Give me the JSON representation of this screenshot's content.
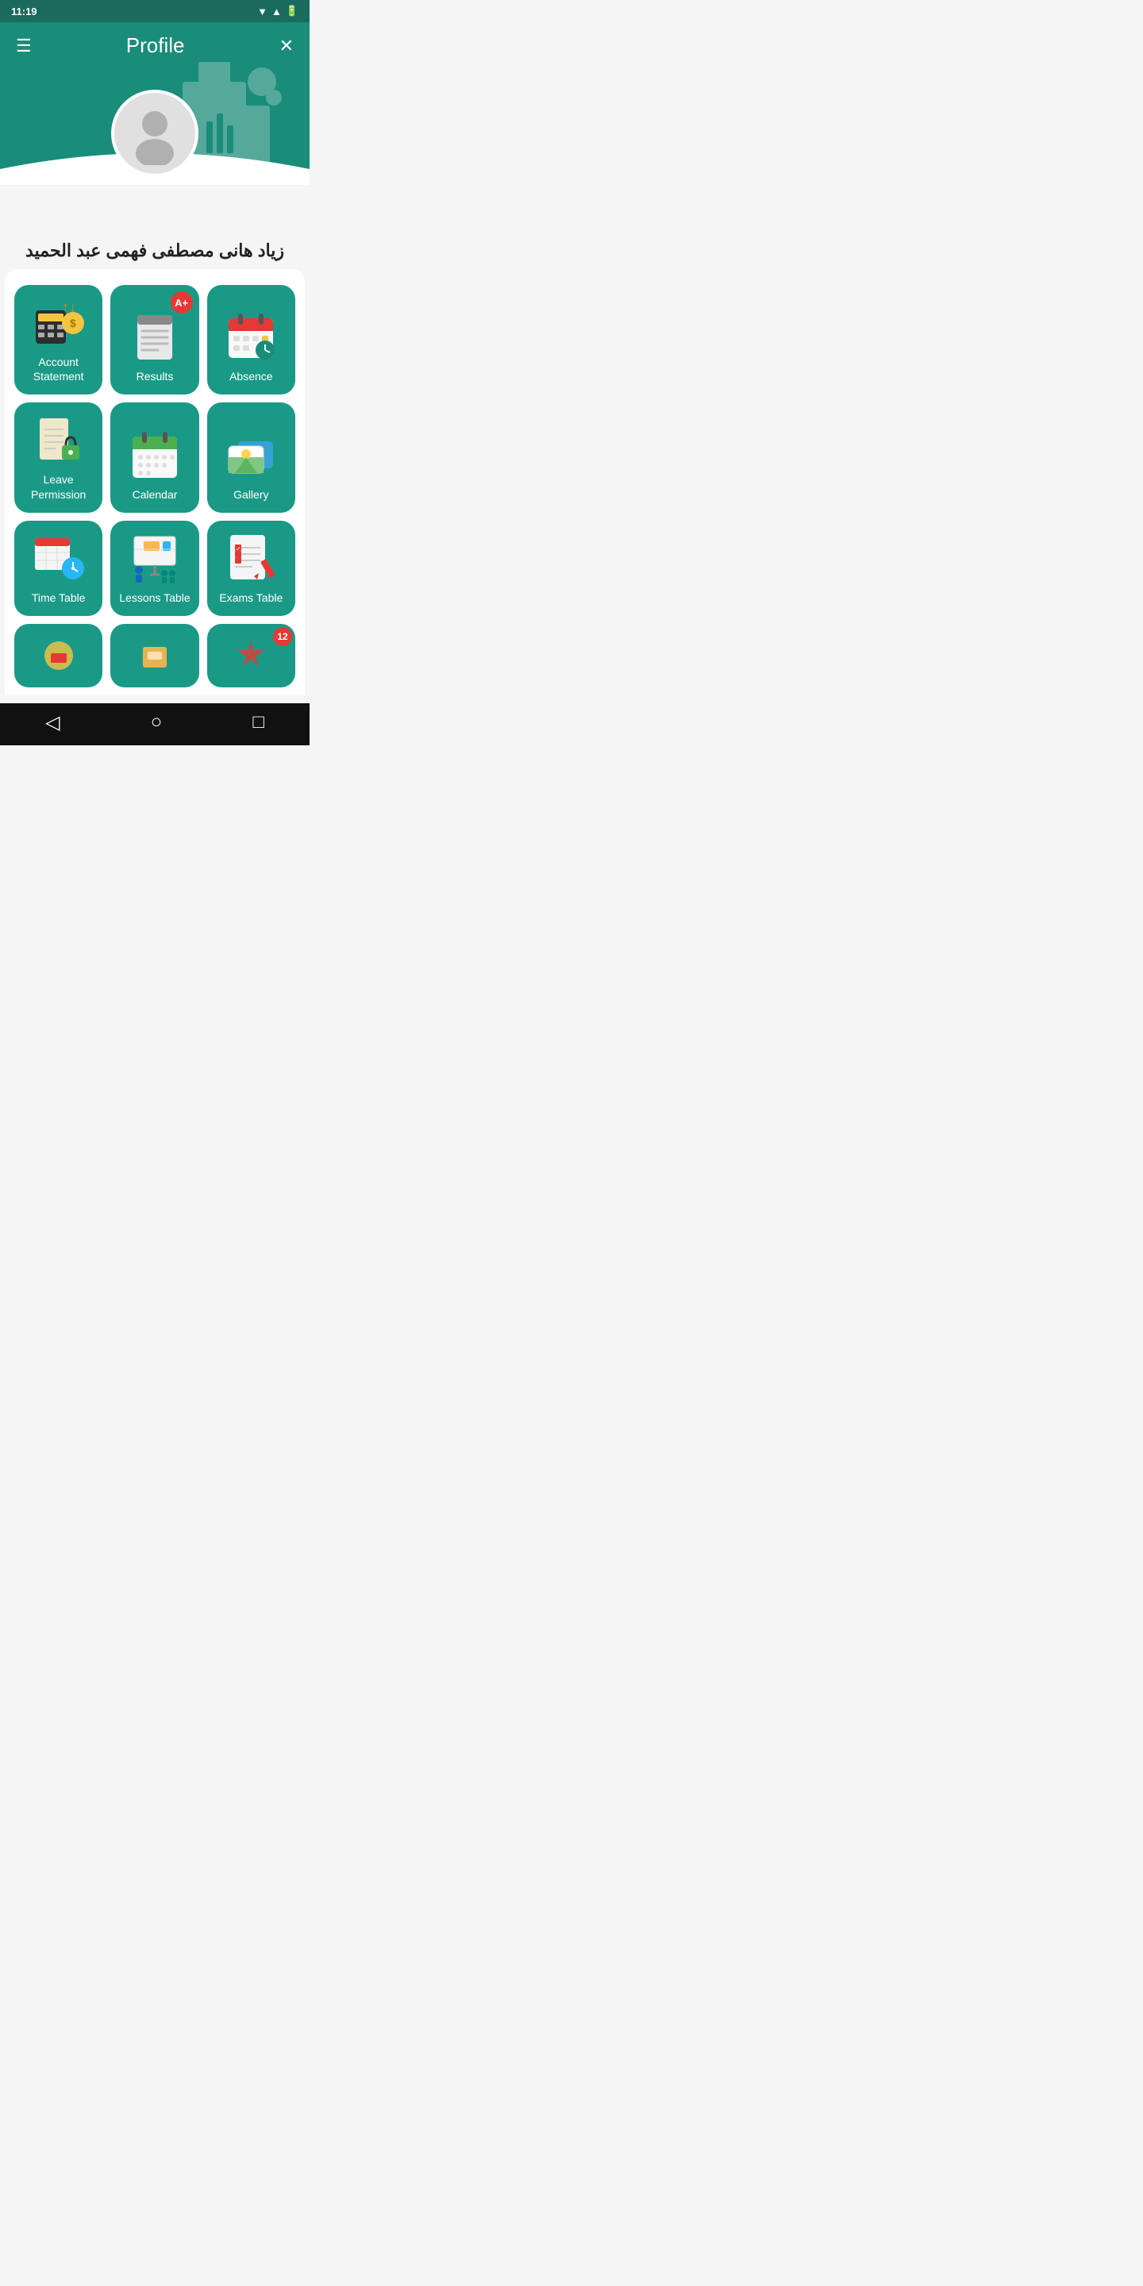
{
  "status_bar": {
    "time": "11:19"
  },
  "header": {
    "title": "Profile",
    "menu_label": "☰",
    "close_label": "✕"
  },
  "user": {
    "name": "زياد هانى مصطفى فهمى عبد الحميد"
  },
  "grid_items": [
    {
      "id": "account-statement",
      "label": "Account Statement",
      "badge": null,
      "icon": "account"
    },
    {
      "id": "results",
      "label": "Results",
      "badge": "A+",
      "icon": "results"
    },
    {
      "id": "absence",
      "label": "Absence",
      "badge": null,
      "icon": "absence"
    },
    {
      "id": "leave-permission",
      "label": "Leave Permission",
      "badge": null,
      "icon": "leave"
    },
    {
      "id": "calendar",
      "label": "Calendar",
      "badge": null,
      "icon": "calendar"
    },
    {
      "id": "gallery",
      "label": "Gallery",
      "badge": null,
      "icon": "gallery"
    },
    {
      "id": "time-table",
      "label": "Time Table",
      "badge": null,
      "icon": "timetable"
    },
    {
      "id": "lessons-table",
      "label": "Lessons Table",
      "badge": null,
      "icon": "lessons"
    },
    {
      "id": "exams-table",
      "label": "Exams Table",
      "badge": null,
      "icon": "exams"
    }
  ],
  "partial_items": [
    {
      "id": "partial-1",
      "badge": null
    },
    {
      "id": "partial-2",
      "badge": null
    },
    {
      "id": "partial-3",
      "badge": "12"
    }
  ],
  "bottom_nav": {
    "back": "◁",
    "home": "○",
    "recent": "□"
  },
  "colors": {
    "primary": "#1a9a86",
    "header_bg": "#1a8c7a",
    "badge_red": "#e53935"
  }
}
